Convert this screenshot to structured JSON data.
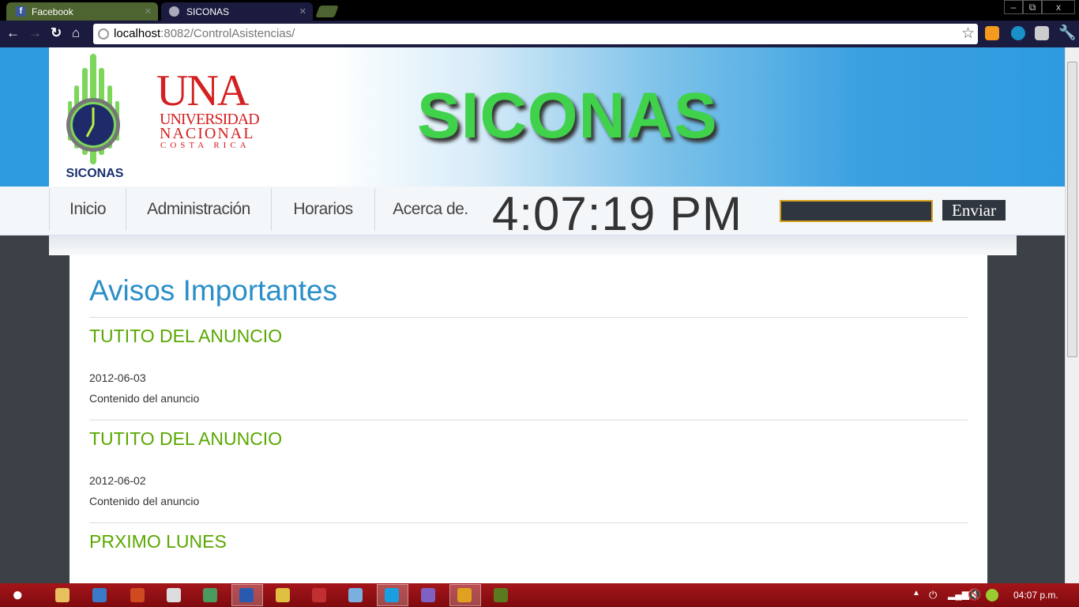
{
  "browser": {
    "tabs": [
      {
        "label": "Facebook",
        "icon": "facebook-icon"
      },
      {
        "label": "SICONAS",
        "icon": "globe-icon"
      }
    ],
    "url_host": "localhost",
    "url_rest": ":8082/ControlAsistencias/",
    "window_controls": {
      "minimize": "–",
      "restore": "⧉",
      "close": "x"
    },
    "extensions": [
      "hotmail-notifier-icon",
      "extension-icon",
      "gmail-checker-icon",
      "wrench-icon"
    ]
  },
  "header": {
    "logo_text": "SICONAS",
    "una_logo": {
      "big": "UNA",
      "line1": "UNIVERSIDAD",
      "line2": "NACIONAL",
      "line3": "COSTA RICA"
    },
    "title": "SICONAS"
  },
  "nav": {
    "items": [
      "Inicio",
      "Administración",
      "Horarios",
      "Acerca de."
    ],
    "clock": "4:07:19 PM",
    "submit_label": "Enviar",
    "input_value": ""
  },
  "main": {
    "heading": "Avisos Importantes",
    "notices": [
      {
        "title": "TUTITO DEL ANUNCIO",
        "date": "2012-06-03",
        "content": "Contenido del anuncio"
      },
      {
        "title": "TUTITO DEL ANUNCIO",
        "date": "2012-06-02",
        "content": "Contenido del anuncio"
      },
      {
        "title": "PRXIMO LUNES"
      }
    ]
  },
  "taskbar": {
    "apps": [
      "explorer",
      "outlook",
      "powerpoint",
      "messenger",
      "network",
      "word",
      "files",
      "snipping",
      "virtualbox",
      "skype",
      "eclipse",
      "chrome",
      "dreamweaver"
    ],
    "active_apps": [
      "word",
      "skype",
      "chrome"
    ],
    "clock": "04:07 p.m."
  },
  "colors": {
    "accent_blue": "#2a8fc8",
    "notice_green": "#59a800",
    "taskbar": "#8b0f12",
    "title_green": "#3fd24a"
  }
}
